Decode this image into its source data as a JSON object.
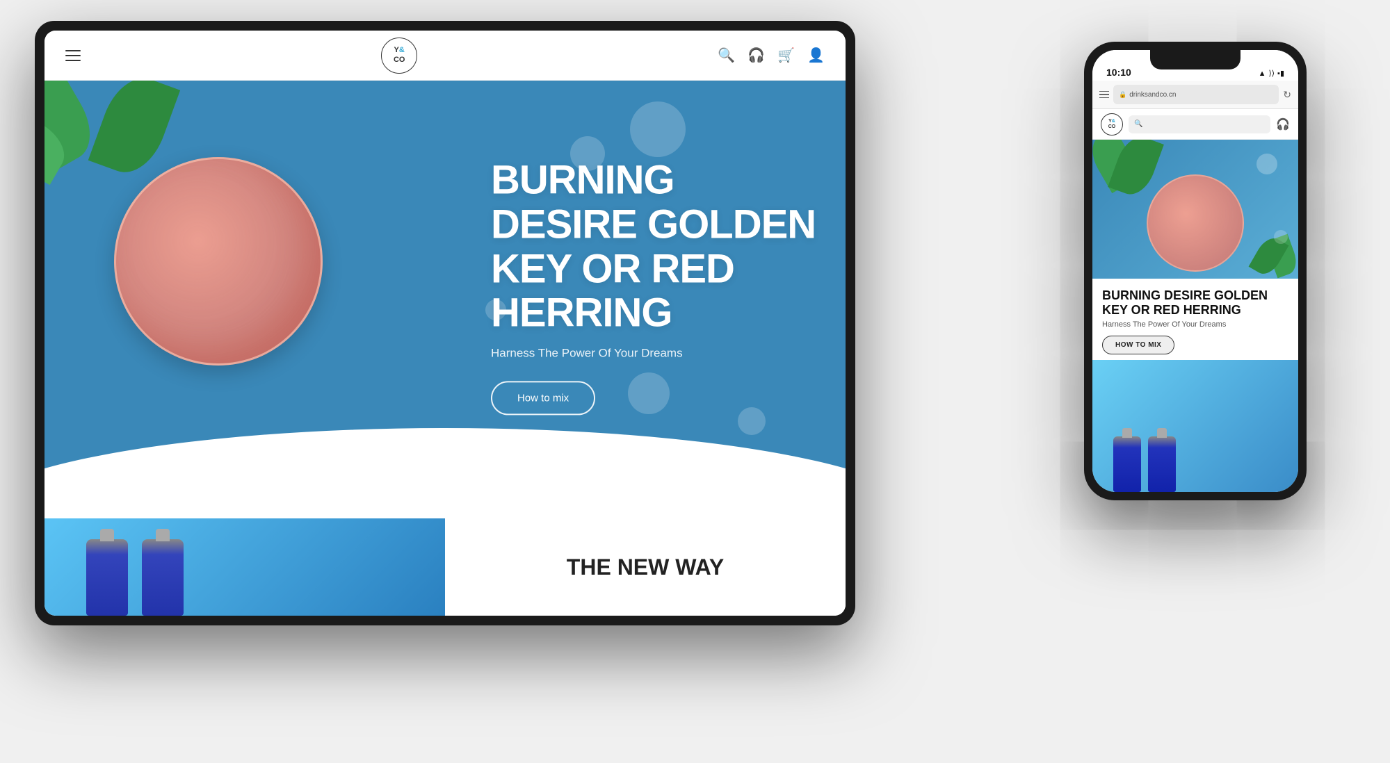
{
  "scene": {
    "bg_color": "#e8e8e8"
  },
  "tablet": {
    "nav": {
      "logo_line1": "Y",
      "logo_ampersand": "&",
      "logo_line2": "CO"
    },
    "hero": {
      "title": "BURNING DESIRE GOLDEN KEY OR RED HERRING",
      "subtitle": "Harness The Power Of Your Dreams",
      "cta_label": "How to mix"
    },
    "bottom": {
      "card2_text": "THE NEW WAY"
    }
  },
  "phone": {
    "status": {
      "time": "10:10",
      "signal": "▲",
      "wifi": "WiFi",
      "battery": "▪▪▪"
    },
    "browser": {
      "url": "drinksandco.cn",
      "lock_icon": "🔒"
    },
    "nav": {
      "search_placeholder": "Search",
      "logo_line1": "Y",
      "logo_amp": "&",
      "logo_line2": "CO"
    },
    "hero": {
      "title": "BURNING DESIRE GOLDEN KEY OR RED HERRING",
      "subtitle": "Harness The Power Of Your Dreams",
      "cta_label": "HOW TO MIX"
    }
  }
}
